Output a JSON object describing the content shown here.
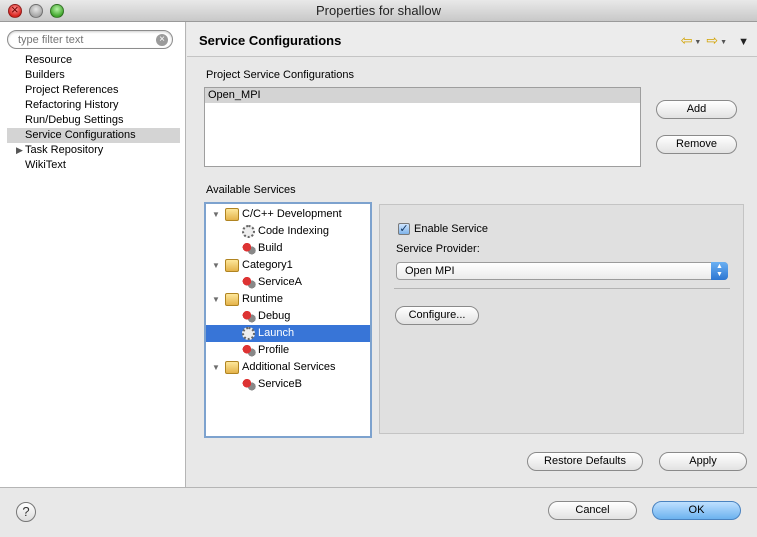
{
  "window": {
    "title": "Properties for shallow"
  },
  "sidebar": {
    "filter_placeholder": "type filter text",
    "items": [
      {
        "label": "Resource"
      },
      {
        "label": "Builders"
      },
      {
        "label": "Project References"
      },
      {
        "label": "Refactoring History"
      },
      {
        "label": "Run/Debug Settings"
      },
      {
        "label": "Service Configurations",
        "selected": true
      },
      {
        "label": "Task Repository",
        "expandable": true
      },
      {
        "label": "WikiText"
      }
    ]
  },
  "header": {
    "title": "Service Configurations"
  },
  "project_configs": {
    "label": "Project Service Configurations",
    "items": [
      "Open_MPI"
    ],
    "add_label": "Add",
    "remove_label": "Remove"
  },
  "services": {
    "label": "Available Services",
    "tree": [
      {
        "label": "C/C++ Development",
        "kind": "folder-icon"
      },
      {
        "label": "Code Indexing",
        "kind": "gear-icon"
      },
      {
        "label": "Build",
        "kind": "service-icon"
      },
      {
        "label": "Category1",
        "kind": "folder-icon"
      },
      {
        "label": "ServiceA",
        "kind": "service-icon"
      },
      {
        "label": "Runtime",
        "kind": "folder-icon"
      },
      {
        "label": "Debug",
        "kind": "service-icon"
      },
      {
        "label": "Launch",
        "kind": "gear-icon",
        "selected": true
      },
      {
        "label": "Profile",
        "kind": "service-icon"
      },
      {
        "label": "Additional Services",
        "kind": "folder-icon"
      },
      {
        "label": "ServiceB",
        "kind": "service-icon"
      }
    ]
  },
  "detail": {
    "enable_label": "Enable Service",
    "enabled": true,
    "provider_label": "Service Provider:",
    "provider_value": "Open MPI",
    "configure_label": "Configure..."
  },
  "actions": {
    "restore_label": "Restore Defaults",
    "apply_label": "Apply",
    "cancel_label": "Cancel",
    "ok_label": "OK",
    "help_glyph": "?"
  },
  "colors": {
    "selection": "#3875d7",
    "accent_border": "#7da2ce"
  }
}
